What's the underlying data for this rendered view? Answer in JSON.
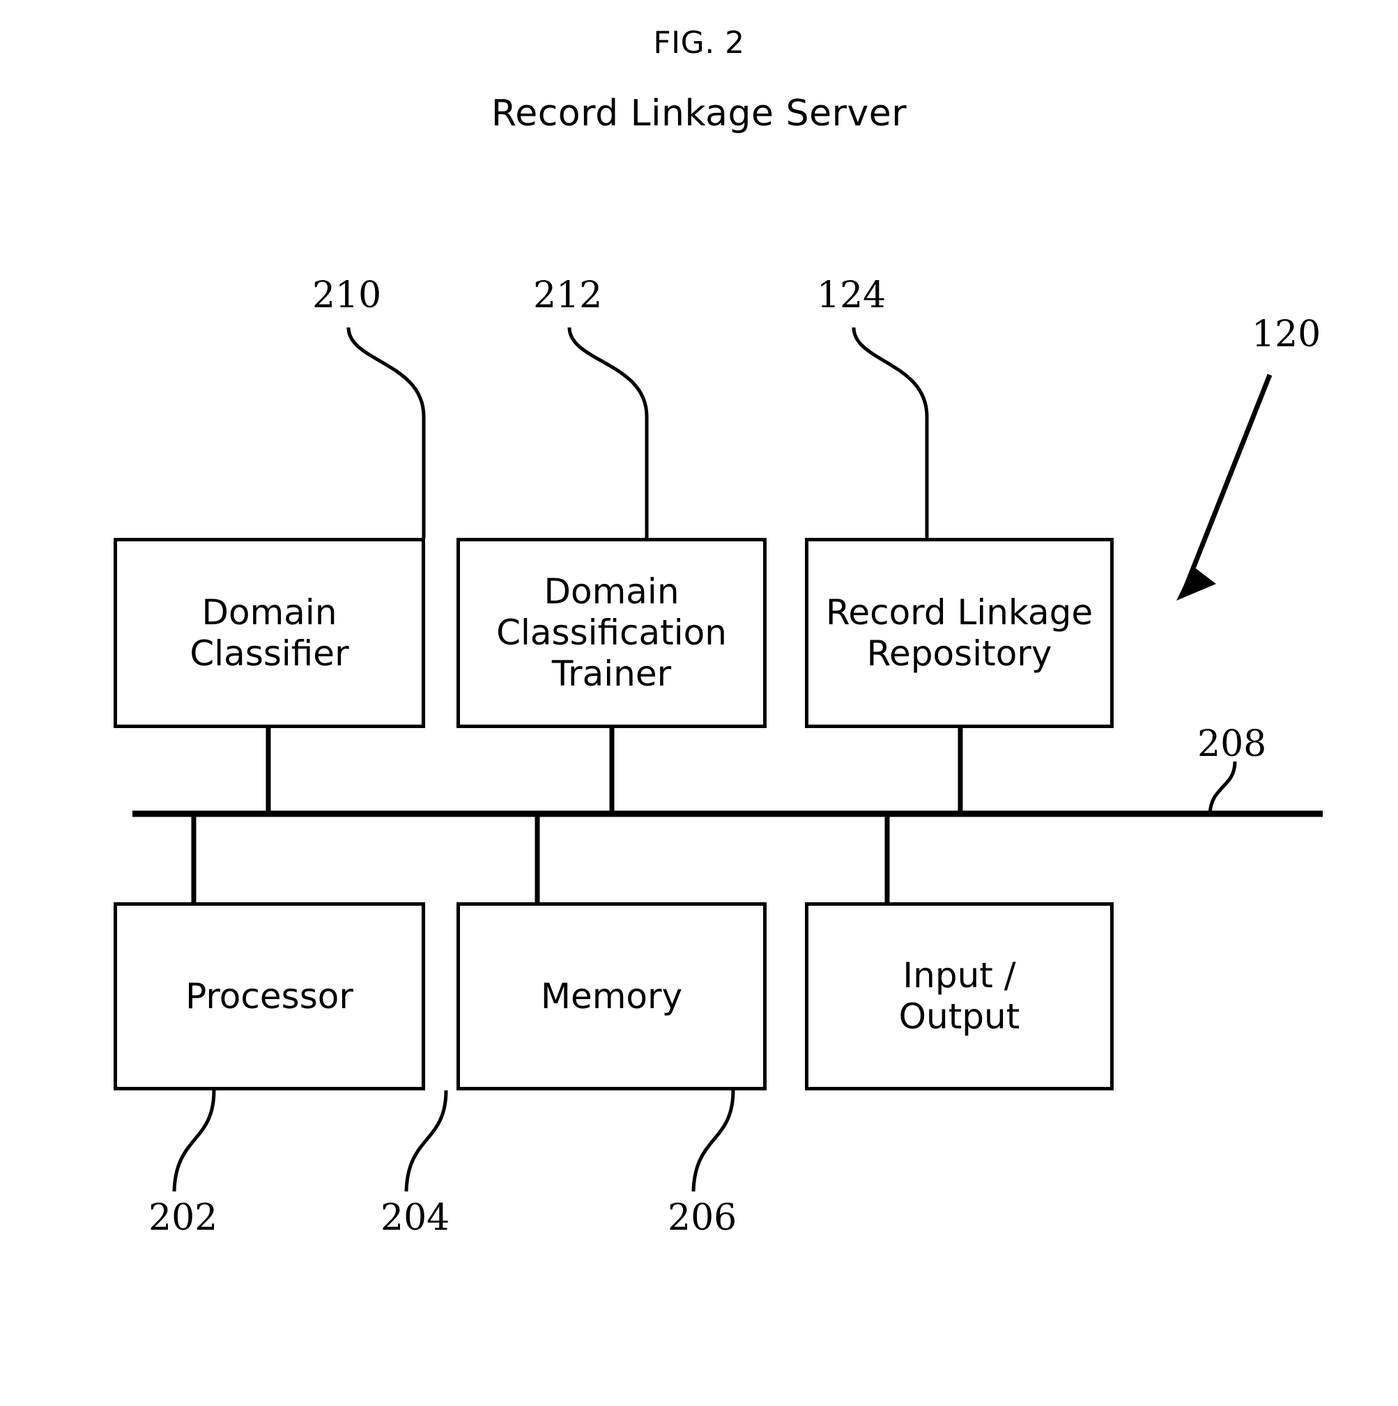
{
  "figure": {
    "label": "FIG. 2",
    "subtitle": "Record Linkage Server"
  },
  "diagram_data": {
    "type": "block-diagram",
    "title": "Record Linkage Server",
    "figure_number": "FIG. 2",
    "system_reference": "120",
    "bus_reference": "208",
    "nodes": [
      {
        "id": "domain-classifier",
        "label": "Domain\nClassifier",
        "ref": "210",
        "row": "top",
        "column": 1
      },
      {
        "id": "domain-classification-trainer",
        "label": "Domain\nClassification\nTrainer",
        "ref": "212",
        "row": "top",
        "column": 2
      },
      {
        "id": "record-linkage-repository",
        "label": "Record Linkage\nRepository",
        "ref": "124",
        "row": "top",
        "column": 3
      },
      {
        "id": "processor",
        "label": "Processor",
        "ref": "202",
        "row": "bottom",
        "column": 1
      },
      {
        "id": "memory",
        "label": "Memory",
        "ref": "204",
        "row": "bottom",
        "column": 2
      },
      {
        "id": "input-output",
        "label": "Input /\nOutput",
        "ref": "206",
        "row": "bottom",
        "column": 3
      }
    ],
    "connections": [
      {
        "from": "domain-classifier",
        "to": "bus"
      },
      {
        "from": "domain-classification-trainer",
        "to": "bus"
      },
      {
        "from": "record-linkage-repository",
        "to": "bus"
      },
      {
        "from": "bus",
        "to": "processor"
      },
      {
        "from": "bus",
        "to": "memory"
      },
      {
        "from": "bus",
        "to": "input-output"
      }
    ],
    "colors": {
      "stroke": "#000000",
      "fill": "#ffffff",
      "text": "#000000"
    }
  },
  "boxes": {
    "domain_classifier": {
      "label": "Domain\nClassifier"
    },
    "domain_classification_trainer": {
      "label": "Domain\nClassification\nTrainer"
    },
    "record_linkage_repository": {
      "label": "Record Linkage\nRepository"
    },
    "processor": {
      "label": "Processor"
    },
    "memory": {
      "label": "Memory"
    },
    "input_output": {
      "label": "Input /\nOutput"
    }
  },
  "refs": {
    "r210": "210",
    "r212": "212",
    "r124": "124",
    "r120": "120",
    "r208": "208",
    "r202": "202",
    "r204": "204",
    "r206": "206"
  }
}
